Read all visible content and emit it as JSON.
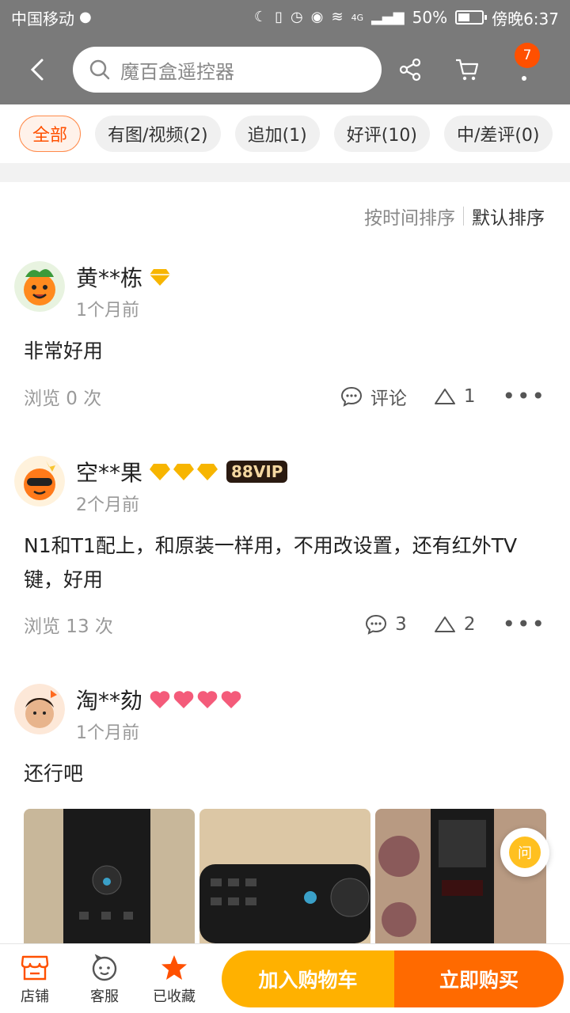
{
  "status": {
    "carrier": "中国移动",
    "network": "4G",
    "battery": "50%",
    "time": "傍晚6:37"
  },
  "nav": {
    "search_placeholder": "魔百盒遥控器",
    "cart_badge": "7"
  },
  "filters": [
    {
      "label": "全部",
      "active": true
    },
    {
      "label": "有图/视频(2)",
      "active": false
    },
    {
      "label": "追加(1)",
      "active": false
    },
    {
      "label": "好评(10)",
      "active": false
    },
    {
      "label": "中/差评(0)",
      "active": false
    }
  ],
  "sort": {
    "by_time": "按时间排序",
    "default": "默认排序"
  },
  "reviews": [
    {
      "user": "黄**栋",
      "time": "1个月前",
      "text": "非常好用",
      "views": "浏览 0 次",
      "comment_label": "评论",
      "likes": "1"
    },
    {
      "user": "空**果",
      "badge": "88VIP",
      "time": "2个月前",
      "text": "N1和T1配上，和原装一样用，不用改设置，还有红外TV键，好用",
      "views": "浏览 13 次",
      "comments": "3",
      "likes": "2"
    },
    {
      "user": "淘**劾",
      "time": "1个月前",
      "text": "还行吧"
    }
  ],
  "ask_label": "问",
  "bottom": {
    "shop": "店铺",
    "service": "客服",
    "favorited": "已收藏",
    "add_to_cart": "加入购物车",
    "buy_now": "立即购买"
  },
  "colors": {
    "accent": "#ff5000",
    "cart_button": "#ffb100",
    "buy_button": "#ff6a00"
  }
}
